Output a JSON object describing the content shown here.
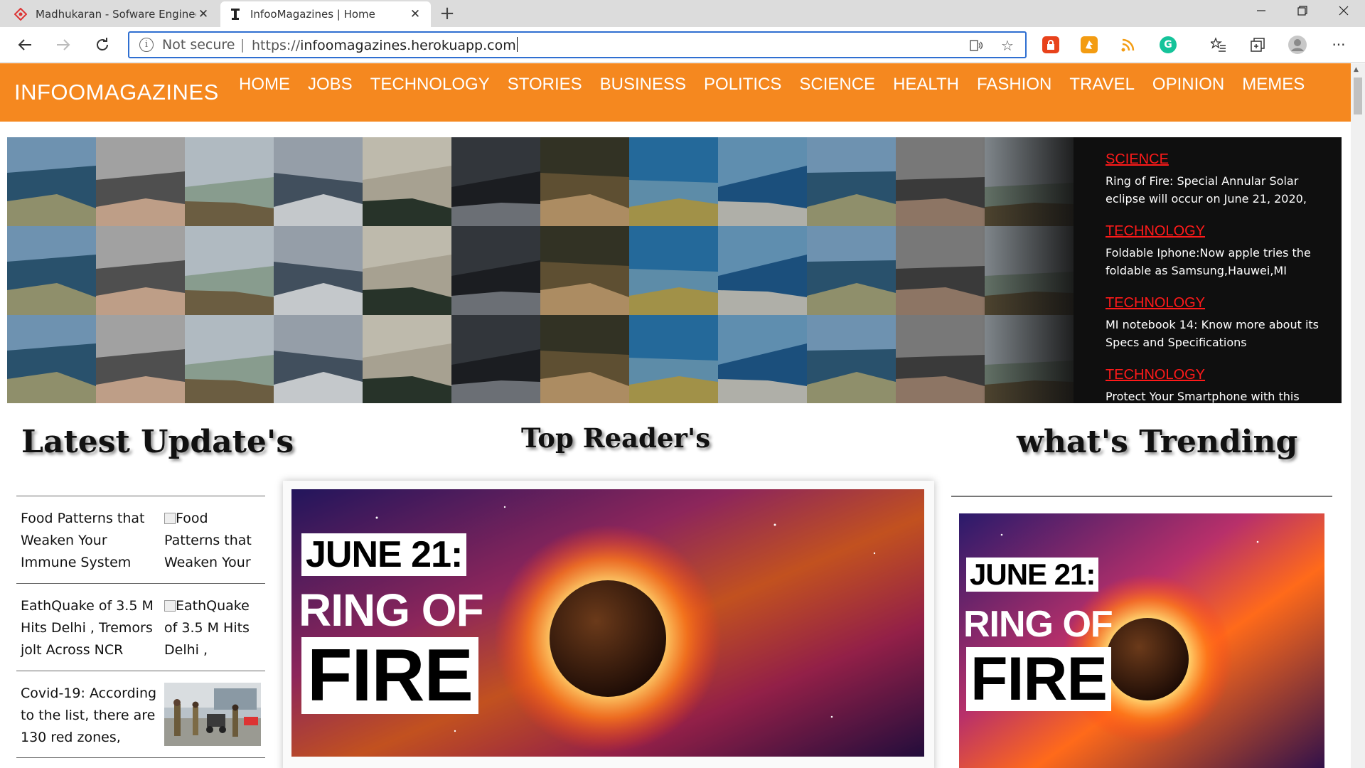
{
  "browser": {
    "tabs": [
      {
        "title": "Madhukaran - Sofware Engineer",
        "close": "✕"
      },
      {
        "title": "InfooMagazines | Home",
        "close": "✕"
      }
    ],
    "new_tab": "+",
    "window_controls": {
      "minimize": "—",
      "maximize": "❐",
      "close": "✕"
    },
    "address_bar": {
      "security_label": "Not secure",
      "separator": "|",
      "url_prefix": "https://",
      "url_host": "infoomagazines.herokuapp.com"
    }
  },
  "site": {
    "brand": "INFOOMAGAZINES",
    "nav": [
      "HOME",
      "JOBS",
      "TECHNOLOGY",
      "STORIES",
      "BUSINESS",
      "POLITICS",
      "SCIENCE",
      "HEALTH",
      "FASHION",
      "TRAVEL",
      "OPINION",
      "MEMES"
    ],
    "accent_color": "#f5881f"
  },
  "hero_news": [
    {
      "category": "SCIENCE",
      "title": "Ring of Fire: Special Annular Solar eclipse will occur on June 21, 2020,"
    },
    {
      "category": "TECHNOLOGY",
      "title": "Foldable Iphone:Now apple tries the foldable as Samsung,Hauwei,MI"
    },
    {
      "category": "TECHNOLOGY",
      "title": "MI notebook 14: Know more about its Specs and Specifications"
    },
    {
      "category": "TECHNOLOGY",
      "title": "Protect Your Smartphone with this techniques"
    }
  ],
  "sections": {
    "latest": "Latest Update's",
    "top": "Top Reader's",
    "trending": "what's Trending"
  },
  "latest_updates": [
    {
      "text": "Food Patterns that Weaken Your Immune System",
      "image_alt": "Food Patterns that Weaken Your"
    },
    {
      "text": "EathQuake of 3.5 M Hits Delhi , Tremors jolt Across NCR",
      "image_alt": "EathQuake of 3.5 M Hits Delhi ,"
    },
    {
      "text": "Covid-19: According to the list, there are 130 red zones,",
      "image_alt": ""
    }
  ],
  "poster": {
    "line1": "JUNE 21:",
    "line2": "RING OF",
    "line3": "FIRE"
  }
}
